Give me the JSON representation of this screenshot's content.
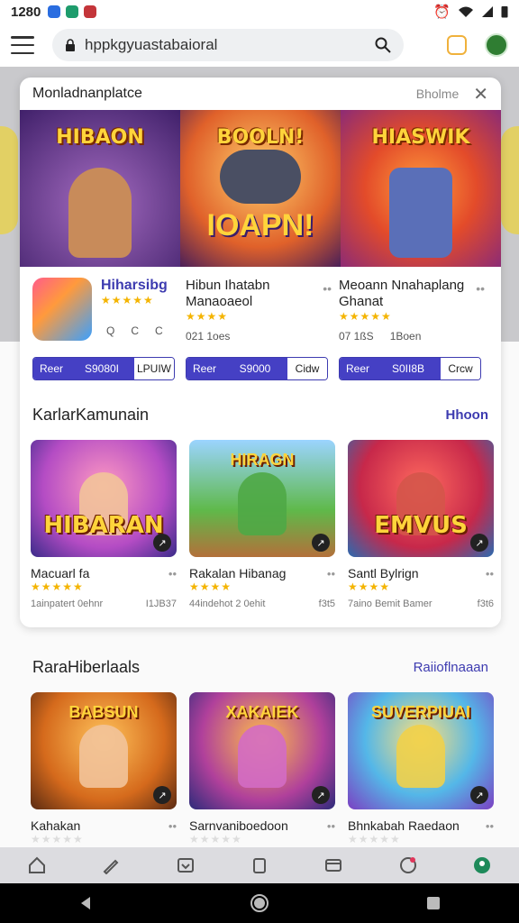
{
  "status_bar": {
    "time": "1280"
  },
  "browser": {
    "url": "hppkgyuastabaioral"
  },
  "modal": {
    "title": "Monladnanplatce",
    "right_label": "Bholme",
    "banner": [
      {
        "label": "HIBAON",
        "sublabel": ""
      },
      {
        "label": "BOOLN!",
        "sublabel": "IOAPN!"
      },
      {
        "label": "HIASWIK",
        "sublabel": ""
      }
    ],
    "featured": [
      {
        "name": "Hiharsibg",
        "line2": "",
        "stars": "★★★★★",
        "meta": [
          "Q",
          "C",
          "C"
        ],
        "buttons": [
          "Reer",
          "S9080I",
          "LPUIW"
        ]
      },
      {
        "name": "Hibun Ihatabn",
        "line2": "Manaoaeol",
        "stars": "★★★★",
        "meta": [
          "021 1oes"
        ],
        "buttons": [
          "Reer",
          "S9000",
          "Cidw"
        ]
      },
      {
        "name": "Meoann Nnahaplang",
        "line2": "Ghanat",
        "stars": "★★★★★",
        "meta": [
          "07 1ßS",
          "1Boen"
        ],
        "buttons": [
          "Reer",
          "S0II8B",
          "Crcw"
        ]
      }
    ],
    "section1": {
      "title": "KarlarKamunain",
      "link": "Hhoon",
      "cards": [
        {
          "top": "",
          "label": "HIBARAN",
          "name": "Macuarl fa",
          "stars": "★★★★★",
          "meta_left": "1ainpatert 0ehnr",
          "meta_right": "I1JB37"
        },
        {
          "top": "HIRAGN",
          "label": "",
          "name": "Rakalan Hibanag",
          "stars": "★★★★",
          "meta_left": "44indehot 2 0ehit",
          "meta_right": "f3t5"
        },
        {
          "top": "",
          "label": "EMVUS",
          "name": "Santl Bylrign",
          "stars": "★★★★",
          "meta_left": "7aino Bemit Bamer",
          "meta_right": "f3t6"
        }
      ]
    }
  },
  "section2": {
    "title": "RaraHiberlaals",
    "link": "Raiioflnaaan",
    "cards": [
      {
        "top": "BABSUN",
        "label": "",
        "name": "Kahakan",
        "stars": "★★★★★"
      },
      {
        "top": "XAKAIEK",
        "label": "",
        "name": "Sarnvaniboedoon",
        "stars": "★★★★★"
      },
      {
        "top": "SUVERPIUAI",
        "label": "",
        "name": "Bhnkabah Raedaon",
        "stars": "★★★★★"
      }
    ]
  },
  "icons": {
    "bottom_nav": [
      "home-icon",
      "pen-icon",
      "inbox-icon",
      "clipboard-icon",
      "wallet-icon",
      "chart-icon",
      "user-icon"
    ],
    "system_nav": [
      "back-icon",
      "home-button-icon",
      "recents-icon"
    ]
  },
  "colors": {
    "accent": "#3d3bb0",
    "button": "#4540c4",
    "star": "#f4b400"
  }
}
